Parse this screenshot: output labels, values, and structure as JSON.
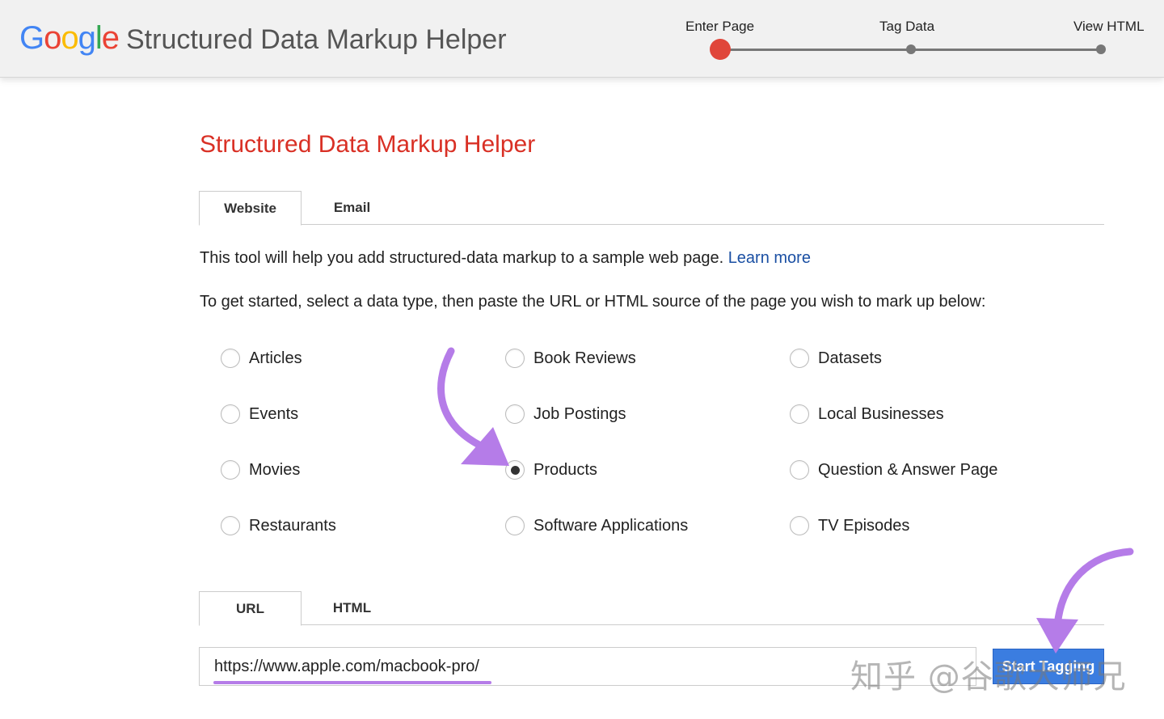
{
  "header": {
    "logo_letters": [
      {
        "char": "G",
        "color": "#4285F4"
      },
      {
        "char": "o",
        "color": "#EA4335"
      },
      {
        "char": "o",
        "color": "#FBBC05"
      },
      {
        "char": "g",
        "color": "#4285F4"
      },
      {
        "char": "l",
        "color": "#34A853"
      },
      {
        "char": "e",
        "color": "#EA4335"
      }
    ],
    "app_title": "Structured Data Markup Helper",
    "steps": [
      {
        "label": "Enter Page",
        "active": true
      },
      {
        "label": "Tag Data",
        "active": false
      },
      {
        "label": "View HTML",
        "active": false
      }
    ]
  },
  "main": {
    "title": "Structured Data Markup Helper",
    "type_tabs": [
      {
        "label": "Website",
        "active": true
      },
      {
        "label": "Email",
        "active": false
      }
    ],
    "intro": "This tool will help you add structured-data markup to a sample web page.",
    "learn_more": "Learn more",
    "instructions": "To get started, select a data type, then paste the URL or HTML source of the page you wish to mark up below:",
    "data_types": [
      [
        "Articles",
        "Book Reviews",
        "Datasets"
      ],
      [
        "Events",
        "Job Postings",
        "Local Businesses"
      ],
      [
        "Movies",
        "Products",
        "Question & Answer Page"
      ],
      [
        "Restaurants",
        "Software Applications",
        "TV Episodes"
      ]
    ],
    "selected_type": "Products",
    "source_tabs": [
      {
        "label": "URL",
        "active": true
      },
      {
        "label": "HTML",
        "active": false
      }
    ],
    "url_value": "https://www.apple.com/macbook-pro/",
    "start_button": "Start Tagging",
    "watermark": "知乎 @谷歌大师兄"
  },
  "colors": {
    "accent_title": "#d93025",
    "active_step": "#e0463a",
    "link": "#1a4fa3",
    "button": "#3b7de0",
    "annotation_arrow": "#b57ce8"
  }
}
